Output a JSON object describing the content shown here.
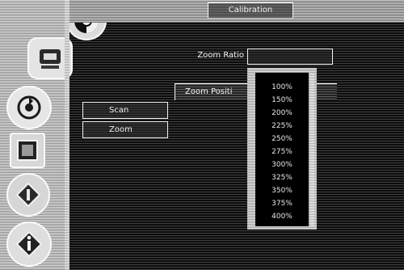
{
  "header": {
    "tab_label": "Calibration"
  },
  "zoom": {
    "ratio_label": "Zoom Ratio",
    "position_label": "Zoom Positi",
    "options": [
      "100%",
      "150%",
      "200%",
      "225%",
      "250%",
      "275%",
      "300%",
      "325%",
      "350%",
      "375%",
      "400%"
    ]
  },
  "buttons": {
    "scan": "Scan",
    "zoom": "Zoom"
  },
  "icons": [
    "display-icon",
    "printer-scan-icon",
    "sync-icon",
    "image-icon",
    "pen-icon",
    "info-icon"
  ]
}
